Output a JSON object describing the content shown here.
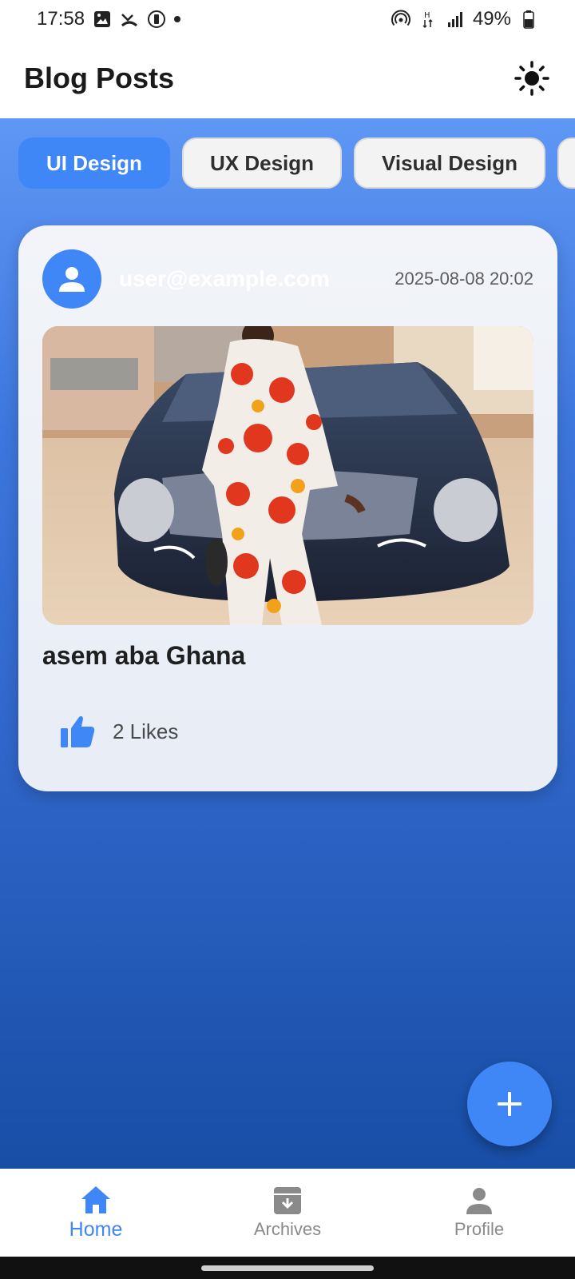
{
  "status_bar": {
    "time": "17:58",
    "battery": "49%"
  },
  "app_bar": {
    "title": "Blog Posts",
    "theme_icon": "sun-icon"
  },
  "categories": {
    "items": [
      {
        "label": "UI Design",
        "active": true
      },
      {
        "label": "UX Design",
        "active": false
      },
      {
        "label": "Visual Design",
        "active": false
      }
    ]
  },
  "post": {
    "author": "user@example.com",
    "date": "2025-08-08 20:02",
    "title": "asem aba Ghana",
    "likes": "2 Likes"
  },
  "fab": {
    "icon": "plus-icon"
  },
  "bottom_nav": {
    "items": [
      {
        "label": "Home",
        "icon": "home-icon",
        "active": true
      },
      {
        "label": "Archives",
        "icon": "archive-icon",
        "active": false
      },
      {
        "label": "Profile",
        "icon": "person-icon",
        "active": false
      }
    ]
  },
  "colors": {
    "accent": "#3f86f7",
    "gradient_top": "#5f97f5",
    "gradient_bottom": "#184ea6"
  }
}
